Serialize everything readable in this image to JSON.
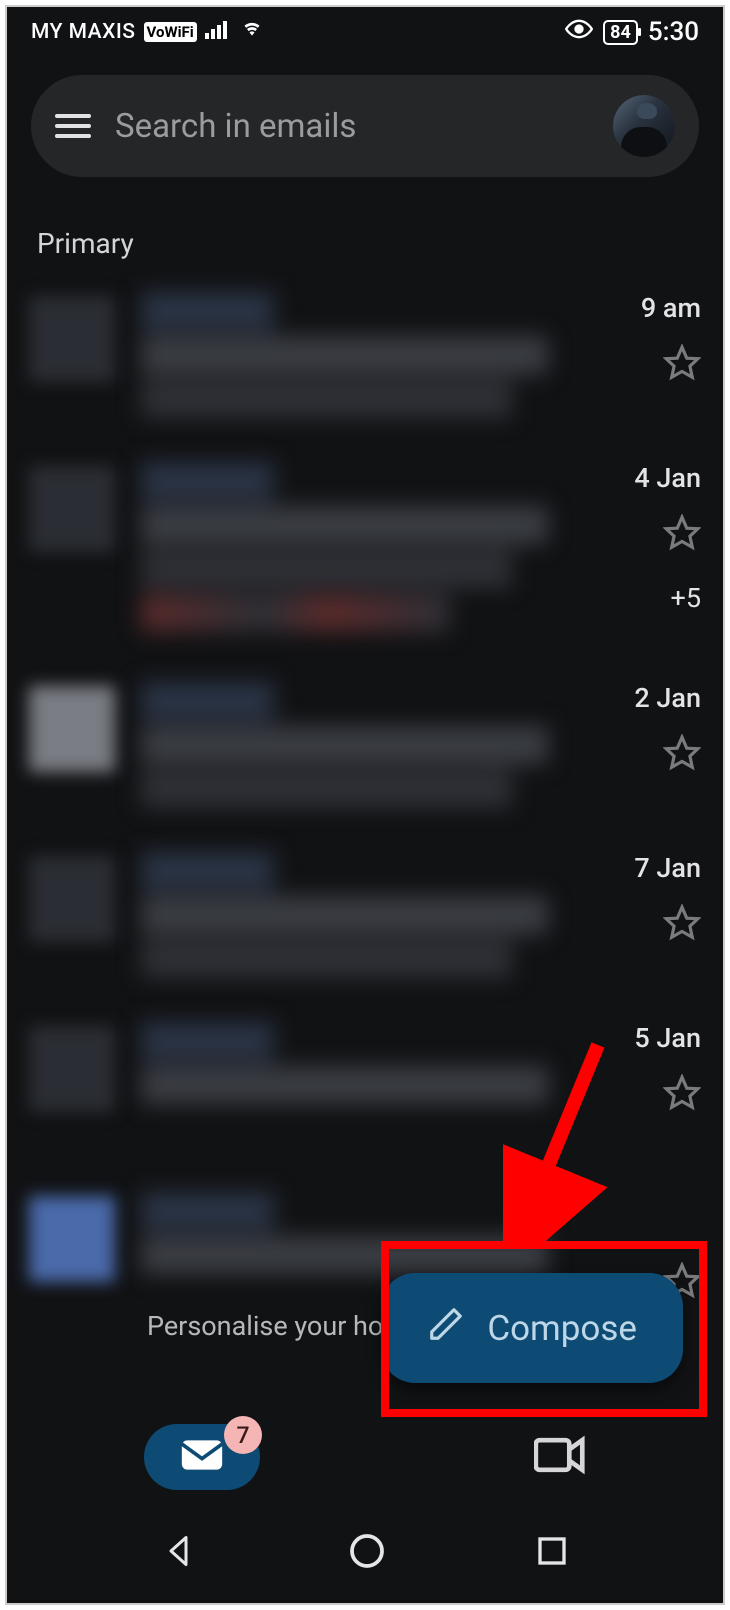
{
  "statusBar": {
    "carrier": "MY MAXIS",
    "wifiCallBadge": "VoWiFi",
    "batteryPercent": "84",
    "time": "5:30"
  },
  "search": {
    "placeholder": "Search in emails"
  },
  "sectionLabel": "Primary",
  "emails": [
    {
      "date": "9 am",
      "extra": ""
    },
    {
      "date": "4 Jan",
      "extra": "+5"
    },
    {
      "date": "2 Jan",
      "extra": ""
    },
    {
      "date": "7 Jan",
      "extra": ""
    },
    {
      "date": "5 Jan",
      "extra": ""
    },
    {
      "date": "",
      "extra": "",
      "snippet": "Personalise your home WiFi now Per"
    }
  ],
  "compose": {
    "label": "Compose"
  },
  "bottomTabs": {
    "mailBadge": "7"
  }
}
